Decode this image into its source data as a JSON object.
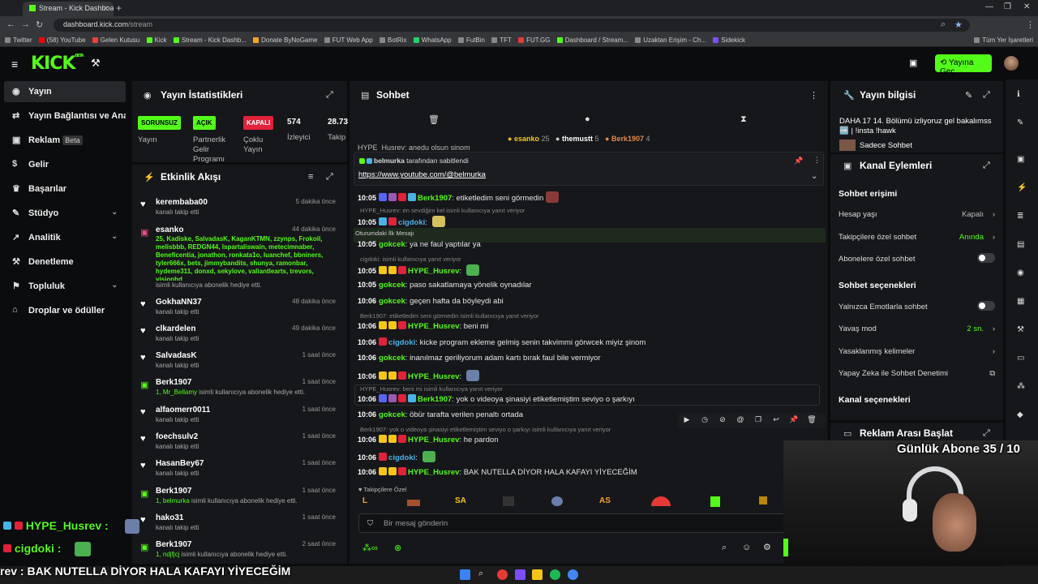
{
  "browser": {
    "tab_title": "Stream - Kick Dashboard",
    "url_host": "dashboard.kick.com",
    "url_path": "/stream",
    "bookmarks": [
      "Twitter",
      "(58) YouTube",
      "Gelen Kutusu",
      "Kick",
      "Stream - Kick Dashb...",
      "Donate ByNoGame",
      "FUT Web App",
      "BotRix",
      "WhatsApp",
      "FutBin",
      "TFT",
      "FUT.GG",
      "Dashboard / Stream...",
      "Uzaktan Erişim - Ch...",
      "Sidekick"
    ],
    "all_bookmarks": "Tüm Yer İşaretleri"
  },
  "app": {
    "logo": "KICK",
    "logo_sup": "BETA",
    "go_live": "Yayına Geç"
  },
  "nav": {
    "items": [
      {
        "label": "Yayın",
        "icon": "◉"
      },
      {
        "label": "Yayın Bağlantısı ve Anahtarı",
        "icon": "⇄"
      },
      {
        "label": "Reklam",
        "icon": "▣",
        "badge": "Beta"
      },
      {
        "label": "Gelir",
        "icon": "$"
      },
      {
        "label": "Başarılar",
        "icon": "♛"
      },
      {
        "label": "Stüdyo",
        "icon": "✎"
      },
      {
        "label": "Analitik",
        "icon": "↗"
      },
      {
        "label": "Denetleme",
        "icon": "⚒"
      },
      {
        "label": "Topluluk",
        "icon": "⚑"
      },
      {
        "label": "Droplar ve ödüller",
        "icon": "⌂"
      }
    ]
  },
  "stats": {
    "title": "Yayın İstatistikleri",
    "items": [
      {
        "badge": "SORUNSUZ",
        "label": "Yayın"
      },
      {
        "badge": "AÇIK",
        "label": "Partnerlik Gelir Programı"
      },
      {
        "badge": "KAPALI",
        "label": "Çoklu Yayın"
      },
      {
        "value": "574",
        "label": "İzleyici"
      },
      {
        "value": "28.73",
        "label": "Takip"
      }
    ]
  },
  "activity": {
    "title": "Etkinlik Akışı",
    "items": [
      {
        "name": "kerembaba00",
        "sub": "kanalı takip etti",
        "time": "5 dakika önce"
      },
      {
        "name": "esanko",
        "time": "44 dakika önce",
        "gifts": "25, Kadiske, SalvadasK, KaganKTMN, zzynps, Frokoil, melisbbb, REDGN44, Ispartaliswain, metecimnaber, Beneficentia, jonathon, ronkata1o, luanchef, bbniners, tyler666x, bets, jimmybandits, shunya, ramonbar, hydeme311, donxd, sekylove, valiantlearts, trevors, visionhd",
        "sub": "isimli kullanıcıya abonelik hediye etti."
      },
      {
        "name": "GokhaNN37",
        "sub": "kanalı takip etti",
        "time": "48 dakika önce"
      },
      {
        "name": "clkardelen",
        "sub": "kanalı takip etti",
        "time": "49 dakika önce"
      },
      {
        "name": "SalvadasK",
        "sub": "kanalı takip etti",
        "time": "1 saat önce"
      },
      {
        "name": "Berk1907",
        "gift_to": "1, Mr_Bellamy",
        "sub": "isimli kullanıcıya abonelik hediye etti.",
        "time": "1 saat önce"
      },
      {
        "name": "alfaomerr0011",
        "sub": "kanalı takip etti",
        "time": "1 saat önce"
      },
      {
        "name": "foechsulv2",
        "sub": "kanalı takip etti",
        "time": "1 saat önce"
      },
      {
        "name": "HasanBey67",
        "sub": "kanalı takip etti",
        "time": "1 saat önce"
      },
      {
        "name": "Berk1907",
        "gift_to": "1, belmurka",
        "sub": "isimli kullanıcıya abonelik hediye etti.",
        "time": "1 saat önce"
      },
      {
        "name": "hako31",
        "sub": "kanalı takip etti",
        "time": "1 saat önce"
      },
      {
        "name": "Berk1907",
        "gift_to": "1, ndjfjcj",
        "sub": "isimli kullanıcıya abonelik hediye etti.",
        "time": "2 saat önce"
      }
    ]
  },
  "chat": {
    "title": "Sohbet",
    "leaders": [
      {
        "name": "esanko",
        "count": "25"
      },
      {
        "name": "themustt",
        "count": "5"
      },
      {
        "name": "Berk1907",
        "count": "4"
      }
    ],
    "top_cut": "HYPE_Husrev: anedu olsun şinom",
    "pinned_by": "belmurka",
    "pinned_by_suffix": "tarafından sabitlendi",
    "pinned_link": "https://www.youtube.com/@belmurka",
    "first_msg_label": "Oturumdaki İlk Mesajı",
    "messages": [
      {
        "ts": "10:05",
        "nick": "Berk1907",
        "text": "etiketledim seni görmedin"
      },
      {
        "reply": "HYPE_Husrev: en sevdiğim kel isimli kullanıcıya yanıt veriyor"
      },
      {
        "ts": "10:05",
        "nick": "cigdoki",
        "text": ""
      },
      {
        "ts": "10:05",
        "nick": "gokcek",
        "text": "ya ne faul yaptılar ya"
      },
      {
        "reply": "cigdoki: isimli kullanıcıya yanıt veriyor"
      },
      {
        "ts": "10:05",
        "nick": "HYPE_Husrev",
        "text": ""
      },
      {
        "ts": "10:05",
        "nick": "gokcek",
        "text": "paso sakatlamaya yönelik oynadılar"
      },
      {
        "ts": "10:06",
        "nick": "gokcek",
        "text": "geçen hafta da böyleydi abi"
      },
      {
        "reply": "Berk1907: etiketledim seni görmedin isimli kullanıcıya yanıt veriyor"
      },
      {
        "ts": "10:06",
        "nick": "HYPE_Husrev",
        "text": "beni mi"
      },
      {
        "ts": "10:06",
        "nick": "cigdoki",
        "text": "kicke program ekleme gelmiş senin takvimmi görwcek miyiz şinom"
      },
      {
        "ts": "10:06",
        "nick": "gokcek",
        "text": "inanılmaz geriliyorum adam kartı bırak faul bile vermiyor"
      },
      {
        "ts": "10:06",
        "nick": "HYPE_Husrev",
        "text": ""
      },
      {
        "reply": "HYPE_Husrev: beni mi isimli kullanıcıya yanıt veriyor"
      },
      {
        "ts": "10:06",
        "nick": "Berk1907",
        "text": "yok o videoya şinasiyi etiketlemiştim seviyo o şarkıyı"
      },
      {
        "ts": "10:06",
        "nick": "gokcek",
        "text": "öbür tarafta verilen penaltı ortada"
      },
      {
        "reply": "Berk1907: yok o videoya şinasiyi etiketlemiştim seviyo o şarkıyı isimli kullanıcıya yanıt veriyor"
      },
      {
        "ts": "10:06",
        "nick": "HYPE_Husrev",
        "text": "he pardon"
      },
      {
        "ts": "10:06",
        "nick": "cigdoki",
        "text": ""
      },
      {
        "ts": "10:06",
        "nick": "HYPE_Husrev",
        "text": "BAK NUTELLA DİYOR HALA KAFAYI YİYECEĞİM"
      }
    ],
    "followers_label": "Takipçilere Özel",
    "emote_bar": [
      "L",
      "SA",
      "AS"
    ],
    "input_placeholder": "Bir mesaj gönderin"
  },
  "info": {
    "title": "Yayın bilgisi",
    "stream_title": "DAHA 17 14. Bölümü izliyoruz gel bakalımss 🆒 | !insta !hawk",
    "category": "Sadece Sohbet"
  },
  "channel": {
    "title": "Kanal Eylemleri",
    "section1": "Sohbet erişimi",
    "rows1": [
      {
        "label": "Hesap yaşı",
        "value": "Kapalı",
        "type": "arrow"
      },
      {
        "label": "Takipçilere özel sohbet",
        "value": "Anında",
        "type": "arrow"
      },
      {
        "label": "Abonelere özel sohbet",
        "type": "toggle"
      }
    ],
    "section2": "Sohbet seçenekleri",
    "rows2": [
      {
        "label": "Yalnızca Emotlarla sohbet",
        "type": "toggle"
      },
      {
        "label": "Yavaş mod",
        "value": "2 sn.",
        "type": "arrow"
      },
      {
        "label": "Yasaklanmış kelimeler",
        "type": "arrow"
      },
      {
        "label": "Yapay Zeka ile Sohbet Denetimi",
        "type": "external"
      }
    ],
    "section3": "Kanal seçenekleri",
    "ad_title": "Reklam Arası Başlat"
  },
  "overlay": {
    "daily_subs": "Günlük Abone 35 / 10",
    "chat1_nick": "HYPE_Husrev :",
    "chat2_nick": "cigdoki :",
    "ticker": "rev : BAK NUTELLA DİYOR HALA KAFAYI YİYECEĞİM"
  },
  "colors": {
    "kick_green": "#53fc18",
    "panel": "#16171a",
    "bg": "#0b0c0e"
  }
}
